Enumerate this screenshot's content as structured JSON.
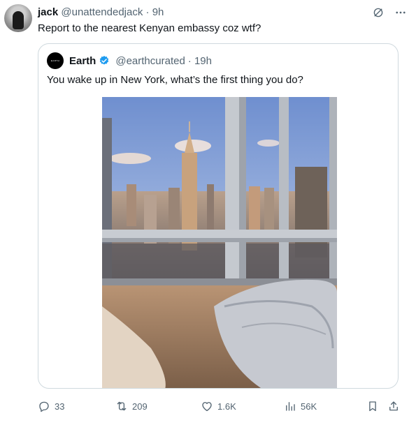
{
  "author": {
    "name": "jack",
    "handle": "@unattendedjack",
    "time": "· 9h",
    "text": "Report to the nearest Kenyan embassy coz wtf?"
  },
  "quoted": {
    "name": "Earth",
    "handle": "@earthcurated",
    "time": "· 19h",
    "text": "You wake up in New York, what’s the first thing you do?",
    "avatar_text": "EARTH",
    "image_description": "Bedroom window view over Manhattan skyline with the Empire State Building"
  },
  "actions": {
    "replies": "33",
    "reposts": "209",
    "likes": "1.6K",
    "views": "56K"
  },
  "colors": {
    "muted": "#536471",
    "verified": "#1d9bf0",
    "border": "#cfd9de"
  },
  "icons": [
    "grok-icon",
    "more-icon",
    "verified-badge-icon",
    "reply-icon",
    "repost-icon",
    "like-icon",
    "views-icon",
    "bookmark-icon",
    "share-icon"
  ]
}
